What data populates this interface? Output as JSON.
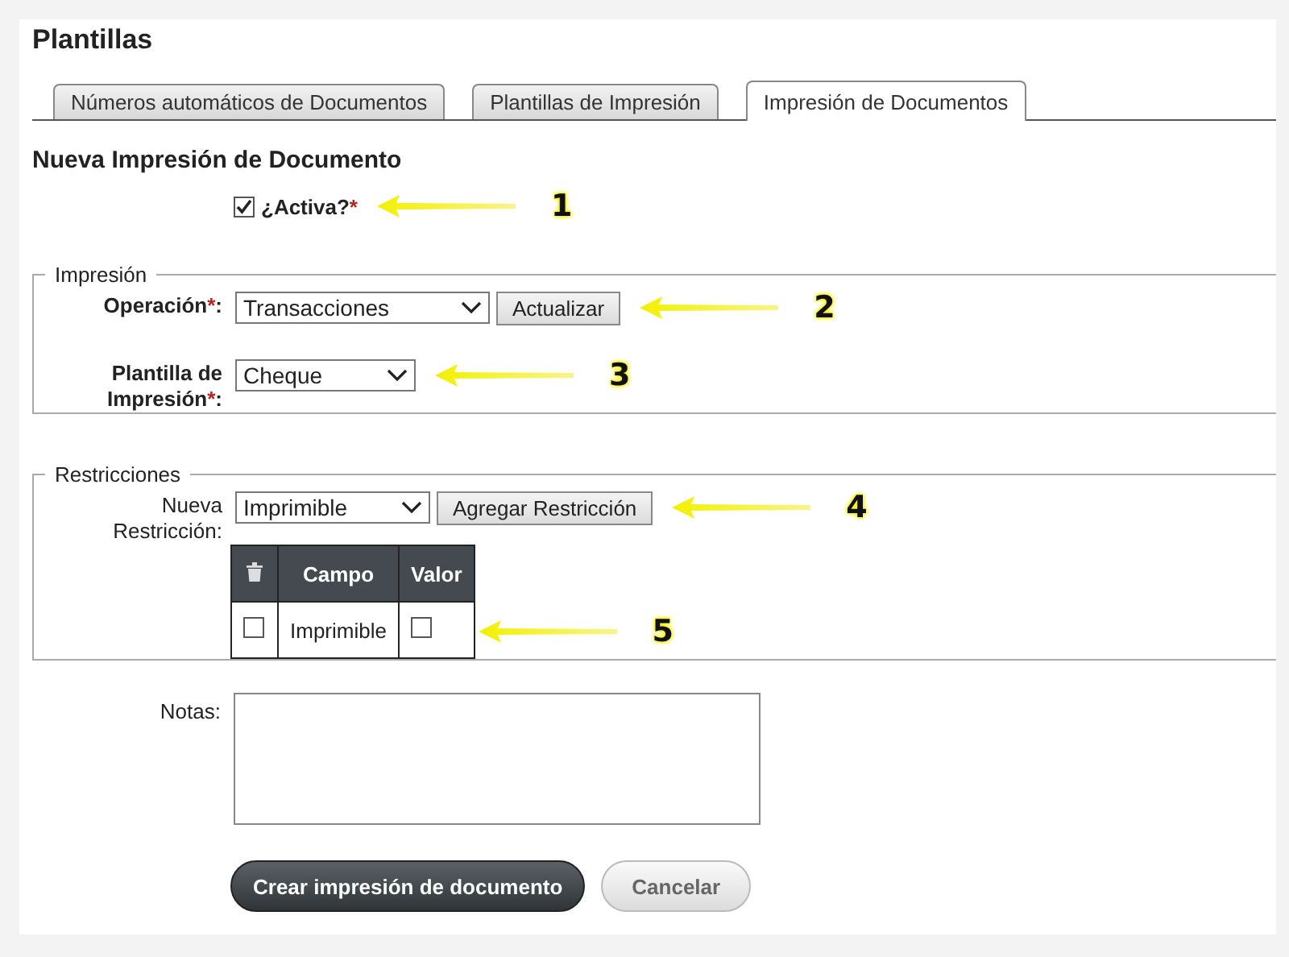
{
  "page_title": "Plantillas",
  "tabs": [
    {
      "label": "Números automáticos de Documentos",
      "selected": false
    },
    {
      "label": "Plantillas de Impresión",
      "selected": false
    },
    {
      "label": "Impresión de Documentos",
      "selected": true
    }
  ],
  "form_title": "Nueva Impresión de Documento",
  "active": {
    "label": "¿Activa?",
    "required_mark": "*",
    "checked": true,
    "callout": "1"
  },
  "impresion": {
    "legend": "Impresión",
    "operation": {
      "label": "Operación",
      "required_mark": "*",
      "label_end": ":",
      "value": "Transacciones",
      "button": "Actualizar",
      "callout": "2"
    },
    "template": {
      "label": "Plantilla de Impresión",
      "required_mark": "*",
      "label_end": ":",
      "value": "Cheque",
      "callout": "3"
    }
  },
  "restricciones": {
    "legend": "Restricciones",
    "new_restriction": {
      "label": "Nueva Restricción:",
      "value": "Imprimible",
      "button": "Agregar Restricción",
      "callout": "4"
    },
    "table": {
      "columns": [
        "Campo",
        "Valor"
      ],
      "rows": [
        {
          "checked": false,
          "campo": "Imprimible",
          "valor": false
        }
      ],
      "callout": "5"
    }
  },
  "notes": {
    "label": "Notas:"
  },
  "buttons": [
    {
      "label": "Crear impresión de documento",
      "kind": "primary"
    },
    {
      "label": "Cancelar",
      "kind": "secondary"
    }
  ]
}
